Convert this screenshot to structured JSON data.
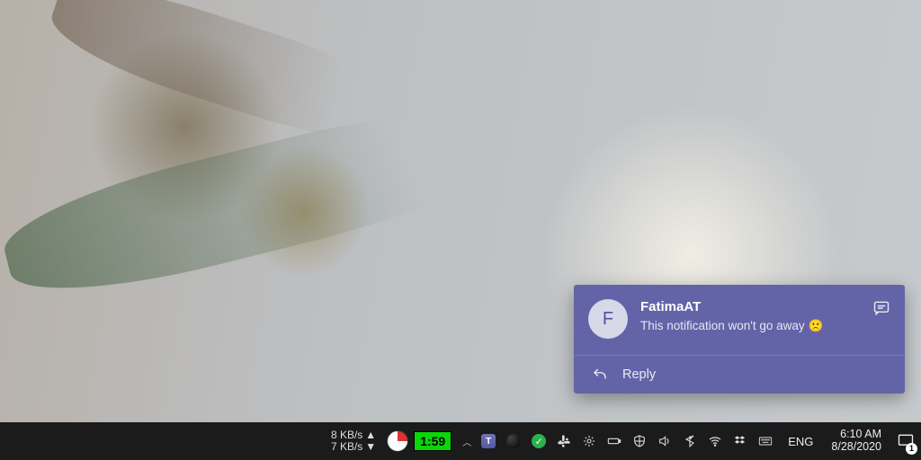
{
  "toast": {
    "sender": "FatimaAT",
    "avatar_initial": "F",
    "message": "This notification won't go away",
    "emoji": "🙁",
    "reply_label": "Reply"
  },
  "netspeed": {
    "up": "8 KB/s",
    "down": "7 KB/s"
  },
  "timer": "1:59",
  "language": "ENG",
  "clock": {
    "time": "6:10 AM",
    "date": "8/28/2020"
  },
  "action_center_count": "1"
}
